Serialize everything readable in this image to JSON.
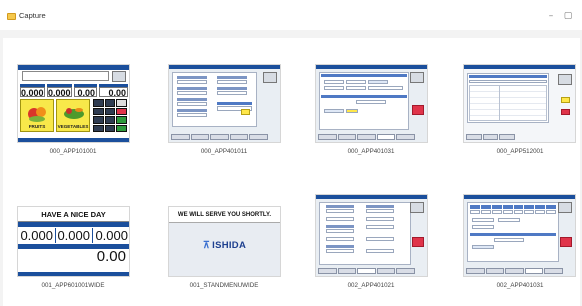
{
  "window": {
    "title": "Capture",
    "minimize": "–",
    "maximize": "▢"
  },
  "thumbnails": [
    {
      "caption": "000_APP101001"
    },
    {
      "caption": "000_APP401011"
    },
    {
      "caption": "000_APP401031"
    },
    {
      "caption": "000_APP512001"
    },
    {
      "caption": "001_APP601001WIDE"
    },
    {
      "caption": "001_STANDMENUWIDE"
    },
    {
      "caption": "002_APP401021"
    },
    {
      "caption": "002_APP401031"
    }
  ],
  "app101001": {
    "values": [
      "0.000",
      "0.000",
      "0.00",
      "0.00"
    ],
    "categories": [
      "FRUITS",
      "VEGETABLES"
    ]
  },
  "app601001wide": {
    "header": "HAVE A NICE DAY",
    "values": [
      "0.000",
      "0.000",
      "0.000"
    ],
    "total": "0.00"
  },
  "standmenu": {
    "message": "WE WILL SERVE YOU SHORTLY.",
    "logo": "ISHIDA"
  }
}
